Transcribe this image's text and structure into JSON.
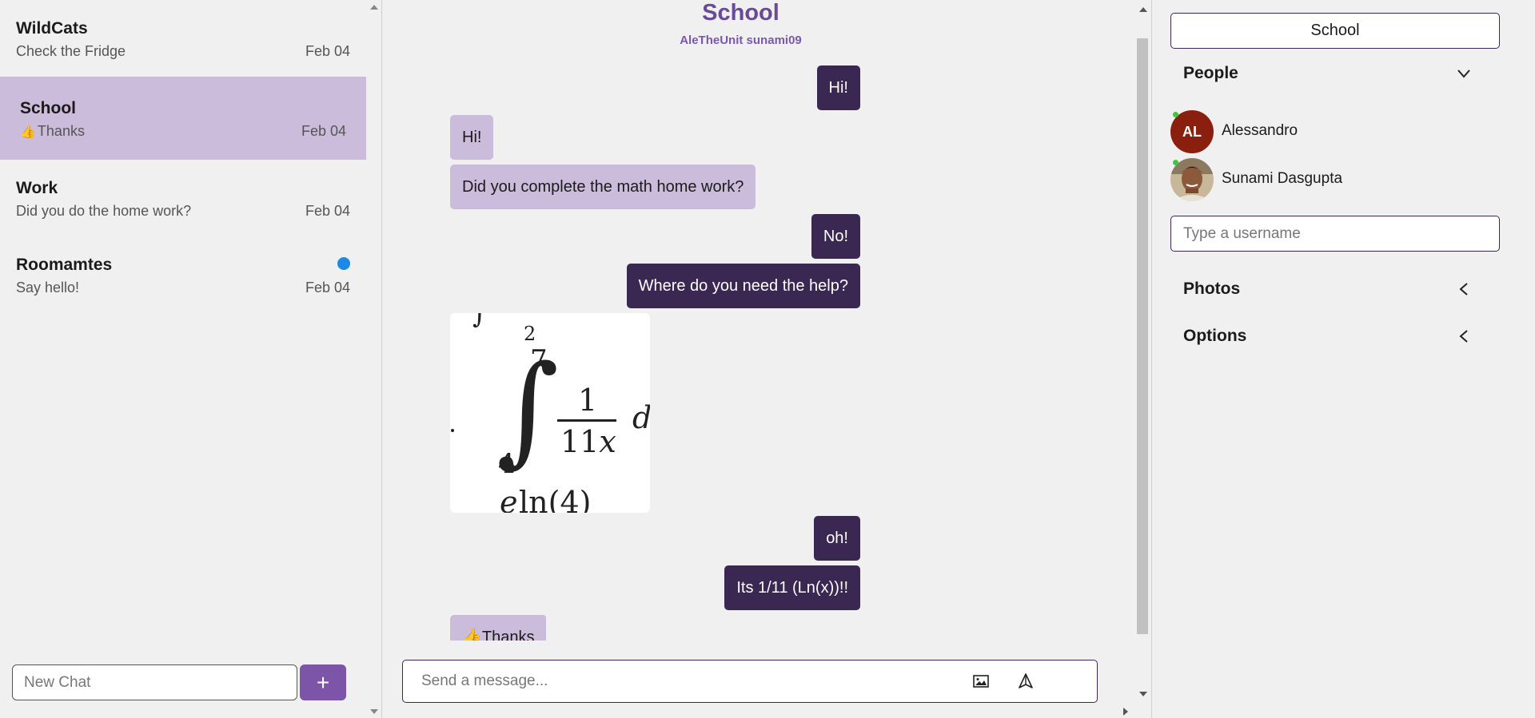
{
  "sidebar": {
    "chats": [
      {
        "name": "WildCats",
        "preview": "Check the Fridge",
        "date": "Feb 04"
      },
      {
        "name": "School",
        "preview": "Thanks",
        "date": "Feb 04"
      },
      {
        "name": "Work",
        "preview": "Did you do the home work?",
        "date": "Feb 04"
      },
      {
        "name": "Roomamtes",
        "preview": "Say hello!",
        "date": "Feb 04"
      }
    ],
    "new_chat_placeholder": "New Chat",
    "add_label": "+"
  },
  "chat": {
    "title": "School",
    "members": "AleTheUnit sunami09",
    "messages": [
      {
        "dir": "out",
        "text": "Hi!"
      },
      {
        "dir": "in",
        "text": "Hi!"
      },
      {
        "dir": "in",
        "text": "Did you complete the math home work?"
      },
      {
        "dir": "out",
        "text": "No!"
      },
      {
        "dir": "out",
        "text": "Where do you need the help?"
      },
      {
        "dir": "in",
        "type": "image",
        "content": "integral from 4 to 7 of 1/(11x)"
      },
      {
        "dir": "out",
        "text": "oh!"
      },
      {
        "dir": "out",
        "text": "Its 1/11 (Ln(x))!!"
      },
      {
        "dir": "in",
        "text": "Thanks"
      }
    ],
    "composer_placeholder": "Send a message...",
    "image_icon": "image-icon",
    "send_icon": "send-icon"
  },
  "details": {
    "group_name": "School",
    "people_label": "People",
    "people": [
      {
        "name": "Alessandro",
        "initials": "AL",
        "online": true
      },
      {
        "name": "Sunami Dasgupta",
        "online": true
      }
    ],
    "username_placeholder": "Type a username",
    "photos_label": "Photos",
    "options_label": "Options"
  },
  "colors": {
    "accent": "#7c54a8",
    "active_chat": "#cbbcdc",
    "outgoing_bubble": "#3a2752",
    "incoming_bubble": "#cbbcdc",
    "unread_dot": "#1e88e5",
    "online": "#3cc83c"
  }
}
